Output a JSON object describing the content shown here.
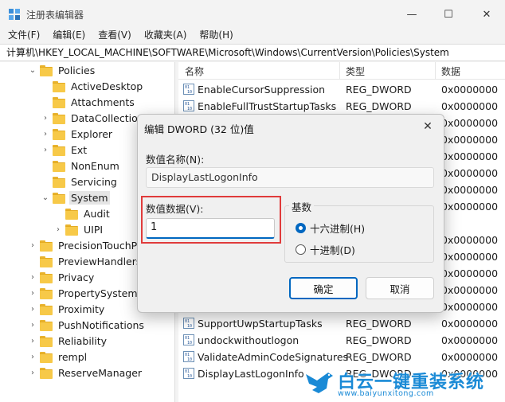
{
  "window": {
    "title": "注册表编辑器",
    "minimize_glyph": "—",
    "maximize_glyph": "☐",
    "close_glyph": "✕"
  },
  "menu": [
    "文件(F)",
    "编辑(E)",
    "查看(V)",
    "收藏夹(A)",
    "帮助(H)"
  ],
  "address": "计算机\\HKEY_LOCAL_MACHINE\\SOFTWARE\\Microsoft\\Windows\\CurrentVersion\\Policies\\System",
  "tree": {
    "items": [
      {
        "label": "Policies",
        "expanded": true
      },
      {
        "label": "ActiveDesktop"
      },
      {
        "label": "Attachments"
      },
      {
        "label": "DataCollection",
        "has_children": true
      },
      {
        "label": "Explorer",
        "has_children": true
      },
      {
        "label": "Ext",
        "has_children": true
      },
      {
        "label": "NonEnum"
      },
      {
        "label": "Servicing"
      },
      {
        "label": "System",
        "expanded": true,
        "selected": true
      },
      {
        "label": "Audit"
      },
      {
        "label": "UIPI",
        "has_children": true
      },
      {
        "label": "PrecisionTouchPa",
        "has_children": true
      },
      {
        "label": "PreviewHandlers"
      },
      {
        "label": "Privacy",
        "has_children": true
      },
      {
        "label": "PropertySystem",
        "has_children": true
      },
      {
        "label": "Proximity",
        "has_children": true
      },
      {
        "label": "PushNotifications",
        "has_children": true
      },
      {
        "label": "Reliability",
        "has_children": true
      },
      {
        "label": "rempl",
        "has_children": true
      },
      {
        "label": "ReserveManager",
        "has_children": true
      }
    ]
  },
  "list": {
    "columns": [
      "名称",
      "类型",
      "数据"
    ],
    "rows": [
      {
        "name": "EnableCursorSuppression",
        "type": "REG_DWORD",
        "data": "0x0000000"
      },
      {
        "name": "EnableFullTrustStartupTasks",
        "type": "REG_DWORD",
        "data": "0x0000000"
      },
      {
        "name": "",
        "type": "",
        "data": "0x0000000"
      },
      {
        "name": "",
        "type": "",
        "data": "0x0000000"
      },
      {
        "name": "",
        "type": "",
        "data": "0x0000000"
      },
      {
        "name": "",
        "type": "",
        "data": "0x0000000"
      },
      {
        "name": "",
        "type": "",
        "data": "0x0000000"
      },
      {
        "name": "",
        "type": "",
        "data": "0x0000000"
      },
      {
        "name": "",
        "type": "",
        "data": ""
      },
      {
        "name": "",
        "type": "",
        "data": "0x0000000"
      },
      {
        "name": "",
        "type": "",
        "data": "0x0000000"
      },
      {
        "name": "",
        "type": "",
        "data": "0x0000000"
      },
      {
        "name": "",
        "type": "",
        "data": "0x0000000"
      },
      {
        "name": "",
        "type": "",
        "data": "0x0000000"
      },
      {
        "name": "SupportUwpStartupTasks",
        "type": "REG_DWORD",
        "data": "0x0000000"
      },
      {
        "name": "undockwithoutlogon",
        "type": "REG_DWORD",
        "data": "0x0000000"
      },
      {
        "name": "ValidateAdminCodeSignatures",
        "type": "REG_DWORD",
        "data": "0x0000000"
      },
      {
        "name": "DisplayLastLogonInfo",
        "type": "REG_DWORD",
        "data": "0x0000000"
      }
    ]
  },
  "dialog": {
    "title": "编辑 DWORD (32 位)值",
    "name_label": "数值名称(N):",
    "name_value": "DisplayLastLogonInfo",
    "data_label": "数值数据(V):",
    "data_value": "1",
    "base_label": "基数",
    "radio_hex": "十六进制(H)",
    "radio_dec": "十进制(D)",
    "selected_base": "hex",
    "ok": "确定",
    "cancel": "取消",
    "highlight_color": "#e03b3b",
    "accent_color": "#0067c0"
  },
  "watermark": {
    "text": "白云一键重装系统",
    "url": "www.baiyunxitong.com"
  }
}
